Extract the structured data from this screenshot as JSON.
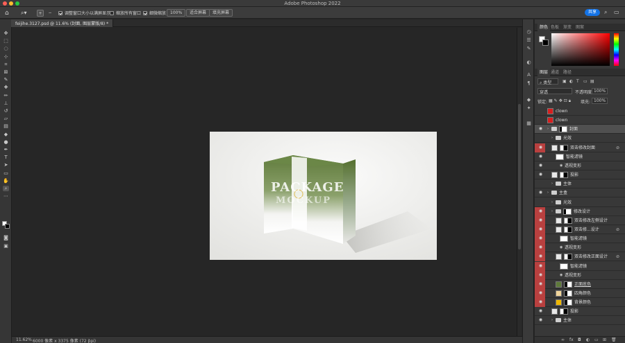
{
  "app": {
    "title": "Adobe Photoshop 2022"
  },
  "options_bar": {
    "resize_windows_label": "调整窗口大小以满屏显示",
    "zoom_all_label": "缩放所有窗口",
    "scrubby_zoom_label": "细微缩放",
    "zoom_percent": "100%",
    "fit_screen_label": "适合屏幕",
    "fill_screen_label": "填充屏幕",
    "share_label": "共享"
  },
  "document_tab": {
    "label": "feijihe.3127.psd @ 11.6% (封面, 图层蒙版/8) *"
  },
  "status": {
    "zoom": "11.62%",
    "size": "6000 像素 x 3375 像素 (72 ppi)"
  },
  "color_panel": {
    "tabs": [
      "颜色",
      "色板",
      "渐变",
      "图案"
    ]
  },
  "layers_panel": {
    "tabs": [
      "图层",
      "通道",
      "路径"
    ],
    "filter_kind": "类型",
    "blend_mode": "穿透",
    "opacity_label": "不透明度:",
    "opacity_value": "100%",
    "lock_label": "锁定:",
    "fill_label": "填充:",
    "fill_value": "100%",
    "layers": [
      {
        "name": "clown",
        "kind": "image",
        "thumb": "#d71f1f",
        "eye": false,
        "red": false,
        "indent": 0,
        "fx": false
      },
      {
        "name": "clown",
        "kind": "image",
        "thumb": "#d71f1f",
        "eye": false,
        "red": false,
        "indent": 0,
        "fx": false
      },
      {
        "name": "封面",
        "kind": "group-mask",
        "eye": true,
        "red": false,
        "indent": 0,
        "fx": false,
        "selected": true
      },
      {
        "name": "光效",
        "kind": "group",
        "eye": false,
        "red": false,
        "indent": 1,
        "fx": false
      },
      {
        "name": "双击修改封面",
        "kind": "smart",
        "eye": true,
        "red": true,
        "indent": 1,
        "fx": true
      },
      {
        "name": "智能滤镜",
        "kind": "filter",
        "eye": true,
        "red": false,
        "indent": 2,
        "fx": false
      },
      {
        "name": "透视变形",
        "kind": "filter-item",
        "eye": true,
        "red": false,
        "indent": 3,
        "fx": false
      },
      {
        "name": "投影",
        "kind": "image-mask",
        "eye": true,
        "red": false,
        "indent": 1,
        "fx": false
      },
      {
        "name": "主体",
        "kind": "group",
        "eye": false,
        "red": false,
        "indent": 1,
        "fx": false
      },
      {
        "name": "主盒",
        "kind": "group",
        "eye": true,
        "red": false,
        "indent": 0,
        "fx": false
      },
      {
        "name": "光效",
        "kind": "group",
        "eye": false,
        "red": false,
        "indent": 1,
        "fx": false
      },
      {
        "name": "修改设计",
        "kind": "group-mask",
        "eye": true,
        "red": true,
        "indent": 1,
        "fx": false
      },
      {
        "name": "双击修改左侧设计",
        "kind": "smart",
        "eye": true,
        "red": true,
        "indent": 2,
        "fx": false
      },
      {
        "name": "双击修...设计",
        "kind": "smart",
        "eye": true,
        "red": true,
        "indent": 2,
        "fx": true
      },
      {
        "name": "智能滤镜",
        "kind": "filter",
        "eye": true,
        "red": true,
        "indent": 3,
        "fx": false
      },
      {
        "name": "透视变形",
        "kind": "filter-item",
        "eye": true,
        "red": true,
        "indent": 3,
        "fx": false
      },
      {
        "name": "双击修改正面设计",
        "kind": "smart",
        "eye": true,
        "red": true,
        "indent": 2,
        "fx": true
      },
      {
        "name": "智能滤镜",
        "kind": "filter",
        "eye": true,
        "red": true,
        "indent": 3,
        "fx": false
      },
      {
        "name": "透视变形",
        "kind": "filter-item",
        "eye": true,
        "red": true,
        "indent": 3,
        "fx": false
      },
      {
        "name": "正面底色",
        "kind": "color",
        "thumb": "#5e7a3a",
        "eye": true,
        "red": true,
        "indent": 2,
        "fx": false
      },
      {
        "name": "四角颜色",
        "kind": "color",
        "thumb": "#f0d49a",
        "eye": true,
        "red": true,
        "indent": 2,
        "fx": false
      },
      {
        "name": "背景颜色",
        "kind": "color",
        "thumb": "#f0b800",
        "eye": true,
        "red": true,
        "indent": 2,
        "fx": false
      },
      {
        "name": "投影",
        "kind": "image-mask",
        "eye": true,
        "red": false,
        "indent": 1,
        "fx": false
      },
      {
        "name": "主体",
        "kind": "group",
        "eye": true,
        "red": false,
        "indent": 1,
        "fx": false
      }
    ]
  },
  "artwork": {
    "line1": "PACKAGE",
    "line2": "MOCKUP"
  },
  "colors": {
    "accent": "#1473e6",
    "box_green": "#5e7a3a",
    "visibility_red": "#b9403f"
  }
}
